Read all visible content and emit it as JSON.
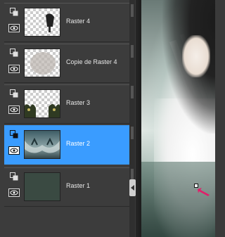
{
  "layers": [
    {
      "name": "Raster 4",
      "selected": false
    },
    {
      "name": "Copie de Raster 4",
      "selected": false
    },
    {
      "name": "Raster 3",
      "selected": false
    },
    {
      "name": "Raster 2",
      "selected": true
    },
    {
      "name": "Raster 1",
      "selected": false
    }
  ],
  "colors": {
    "selected": "#3a9cff",
    "panel": "#3c3c3c",
    "pointer": "#e0206a"
  },
  "icons": {
    "visibility": "eye-icon",
    "layer_group": "layer-stack-icon",
    "collapse": "chevron-left-icon"
  }
}
